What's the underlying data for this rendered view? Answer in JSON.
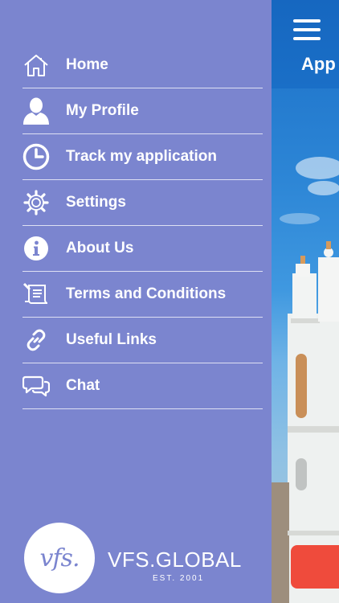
{
  "background": {
    "title_fragment": "App",
    "accent_button_color": "#ef4b3c"
  },
  "drawer": {
    "background_color": "#7b85cf",
    "items": [
      {
        "label": "Home",
        "icon": "home-icon"
      },
      {
        "label": "My Profile",
        "icon": "profile-icon"
      },
      {
        "label": "Track my application",
        "icon": "clock-icon"
      },
      {
        "label": "Settings",
        "icon": "gear-icon"
      },
      {
        "label": "About Us",
        "icon": "info-icon"
      },
      {
        "label": "Terms and Conditions",
        "icon": "document-icon"
      },
      {
        "label": "Useful Links",
        "icon": "link-icon"
      },
      {
        "label": "Chat",
        "icon": "chat-icon"
      }
    ]
  },
  "logo": {
    "mark": "vfs.",
    "name": "VFS.GLOBAL",
    "est": "EST. 2001"
  }
}
